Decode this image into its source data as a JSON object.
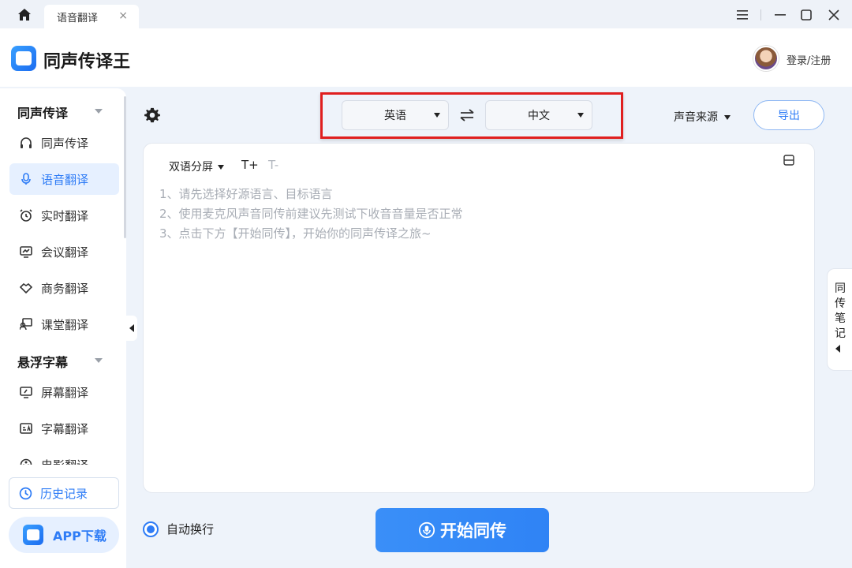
{
  "titlebar": {
    "tab_label": "语音翻译",
    "tab_close": "×"
  },
  "header": {
    "app_name": "同声传译王",
    "login": "登录/注册"
  },
  "sidebar": {
    "section1": "同声传译",
    "section2": "悬浮字幕",
    "items": [
      {
        "label": "同声传译",
        "icon": "headphones-icon"
      },
      {
        "label": "语音翻译",
        "icon": "microphone-icon",
        "active": true
      },
      {
        "label": "实时翻译",
        "icon": "alarm-clock-icon"
      },
      {
        "label": "会议翻译",
        "icon": "chart-board-icon"
      },
      {
        "label": "商务翻译",
        "icon": "handshake-icon"
      },
      {
        "label": "课堂翻译",
        "icon": "teacher-icon"
      },
      {
        "label": "屏幕翻译",
        "icon": "screen-icon"
      },
      {
        "label": "字幕翻译",
        "icon": "subtitle-icon"
      },
      {
        "label": "电影翻译",
        "icon": "film-icon"
      }
    ],
    "history": "历史记录",
    "app_download": "APP下载"
  },
  "toolbar": {
    "source_lang": "英语",
    "target_lang": "中文",
    "sound_source": "声音来源",
    "export": "导出"
  },
  "panel": {
    "split_mode": "双语分屏",
    "font_up": "T+",
    "font_down": "T-",
    "hints": [
      "1、请先选择好源语言、目标语言",
      "2、使用麦克风声音同传前建议先测试下收音音量是否正常",
      "3、点击下方【开始同传】，开始你的同声传译之旅~"
    ]
  },
  "side_tab": {
    "label": "同传笔记"
  },
  "bottom": {
    "auto_wrap": "自动换行",
    "start": "开始同传"
  },
  "colors": {
    "accent": "#2e7cf6",
    "highlight": "#e01f1f"
  }
}
